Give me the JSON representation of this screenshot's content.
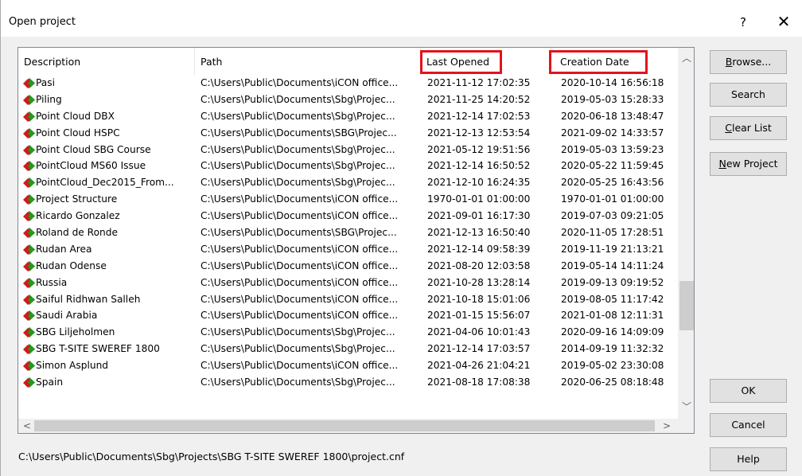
{
  "window": {
    "title": "Open project",
    "help_glyph": "?",
    "close_glyph": "✕"
  },
  "columns": {
    "description": "Description",
    "path": "Path",
    "last_opened": "Last Opened",
    "creation_date": "Creation Date"
  },
  "highlight_color": "#e4121b",
  "icon": "project-diamond-icon",
  "rows": [
    {
      "desc": "Pasi",
      "path": "C:\\Users\\Public\\Documents\\iCON office...",
      "opened": "2021-11-12 17:02:35",
      "created": "2020-10-14 16:56:18"
    },
    {
      "desc": "Piling",
      "path": "C:\\Users\\Public\\Documents\\Sbg\\Projec...",
      "opened": "2021-11-25 14:20:52",
      "created": "2019-05-03 15:28:33"
    },
    {
      "desc": "Point Cloud DBX",
      "path": "C:\\Users\\Public\\Documents\\Sbg\\Projec...",
      "opened": "2021-12-14 17:02:53",
      "created": "2020-06-18 13:48:47"
    },
    {
      "desc": "Point Cloud HSPC",
      "path": "C:\\Users\\Public\\Documents\\SBG\\Projec...",
      "opened": "2021-12-13 12:53:54",
      "created": "2021-09-02 14:33:57"
    },
    {
      "desc": "Point Cloud SBG Course",
      "path": "C:\\Users\\Public\\Documents\\Sbg\\Projec...",
      "opened": "2021-05-12 19:51:56",
      "created": "2019-05-03 13:59:23"
    },
    {
      "desc": "PointCloud MS60 Issue",
      "path": "C:\\Users\\Public\\Documents\\Sbg\\Projec...",
      "opened": "2021-12-14 16:50:52",
      "created": "2020-05-22 11:59:45"
    },
    {
      "desc": "PointCloud_Dec2015_From...",
      "path": "C:\\Users\\Public\\Documents\\Sbg\\Projec...",
      "opened": "2021-12-10 16:24:35",
      "created": "2020-05-25 16:43:56"
    },
    {
      "desc": "Project Structure",
      "path": "C:\\Users\\Public\\Documents\\iCON office...",
      "opened": "1970-01-01 01:00:00",
      "created": "1970-01-01 01:00:00"
    },
    {
      "desc": "Ricardo Gonzalez",
      "path": "C:\\Users\\Public\\Documents\\iCON office...",
      "opened": "2021-09-01 16:17:30",
      "created": "2019-07-03 09:21:05"
    },
    {
      "desc": "Roland de Ronde",
      "path": "C:\\Users\\Public\\Documents\\SBG\\Projec...",
      "opened": "2021-12-13 16:50:40",
      "created": "2020-11-05 17:28:51"
    },
    {
      "desc": "Rudan Area",
      "path": "C:\\Users\\Public\\Documents\\iCON office...",
      "opened": "2021-12-14 09:58:39",
      "created": "2019-11-19 21:13:21"
    },
    {
      "desc": "Rudan Odense",
      "path": "C:\\Users\\Public\\Documents\\iCON office...",
      "opened": "2021-08-20 12:03:58",
      "created": "2019-05-14 14:11:24"
    },
    {
      "desc": "Russia",
      "path": "C:\\Users\\Public\\Documents\\iCON office...",
      "opened": "2021-10-28 13:28:14",
      "created": "2019-09-13 09:19:52"
    },
    {
      "desc": "Saiful Ridhwan Salleh",
      "path": "C:\\Users\\Public\\Documents\\iCON office...",
      "opened": "2021-10-18 15:01:06",
      "created": "2019-08-05 11:17:42"
    },
    {
      "desc": "Saudi Arabia",
      "path": "C:\\Users\\Public\\Documents\\iCON office...",
      "opened": "2021-01-15 15:56:07",
      "created": "2021-01-08 12:11:31"
    },
    {
      "desc": "SBG Liljeholmen",
      "path": "C:\\Users\\Public\\Documents\\Sbg\\Projec...",
      "opened": "2021-04-06 10:01:43",
      "created": "2020-09-16 14:09:09"
    },
    {
      "desc": "SBG T-SITE SWEREF 1800",
      "path": "C:\\Users\\Public\\Documents\\Sbg\\Projec...",
      "opened": "2021-12-14 17:03:57",
      "created": "2014-09-19 11:32:32"
    },
    {
      "desc": "Simon Asplund",
      "path": "C:\\Users\\Public\\Documents\\iCON office...",
      "opened": "2021-04-26 21:04:21",
      "created": "2019-05-02 23:30:08"
    },
    {
      "desc": "Spain",
      "path": "C:\\Users\\Public\\Documents\\Sbg\\Projec...",
      "opened": "2021-08-18 17:08:38",
      "created": "2020-06-25 08:18:48"
    }
  ],
  "buttons": {
    "browse": {
      "u": "B",
      "rest": "rowse..."
    },
    "search": "Search",
    "clear_list": {
      "u": "C",
      "rest": "lear List"
    },
    "new_project": {
      "u": "N",
      "rest": "ew Project"
    },
    "ok": "OK",
    "cancel": "Cancel",
    "help": "Help"
  },
  "selected_path": "C:\\Users\\Public\\Documents\\Sbg\\Projects\\SBG T-SITE SWEREF 1800\\project.cnf"
}
